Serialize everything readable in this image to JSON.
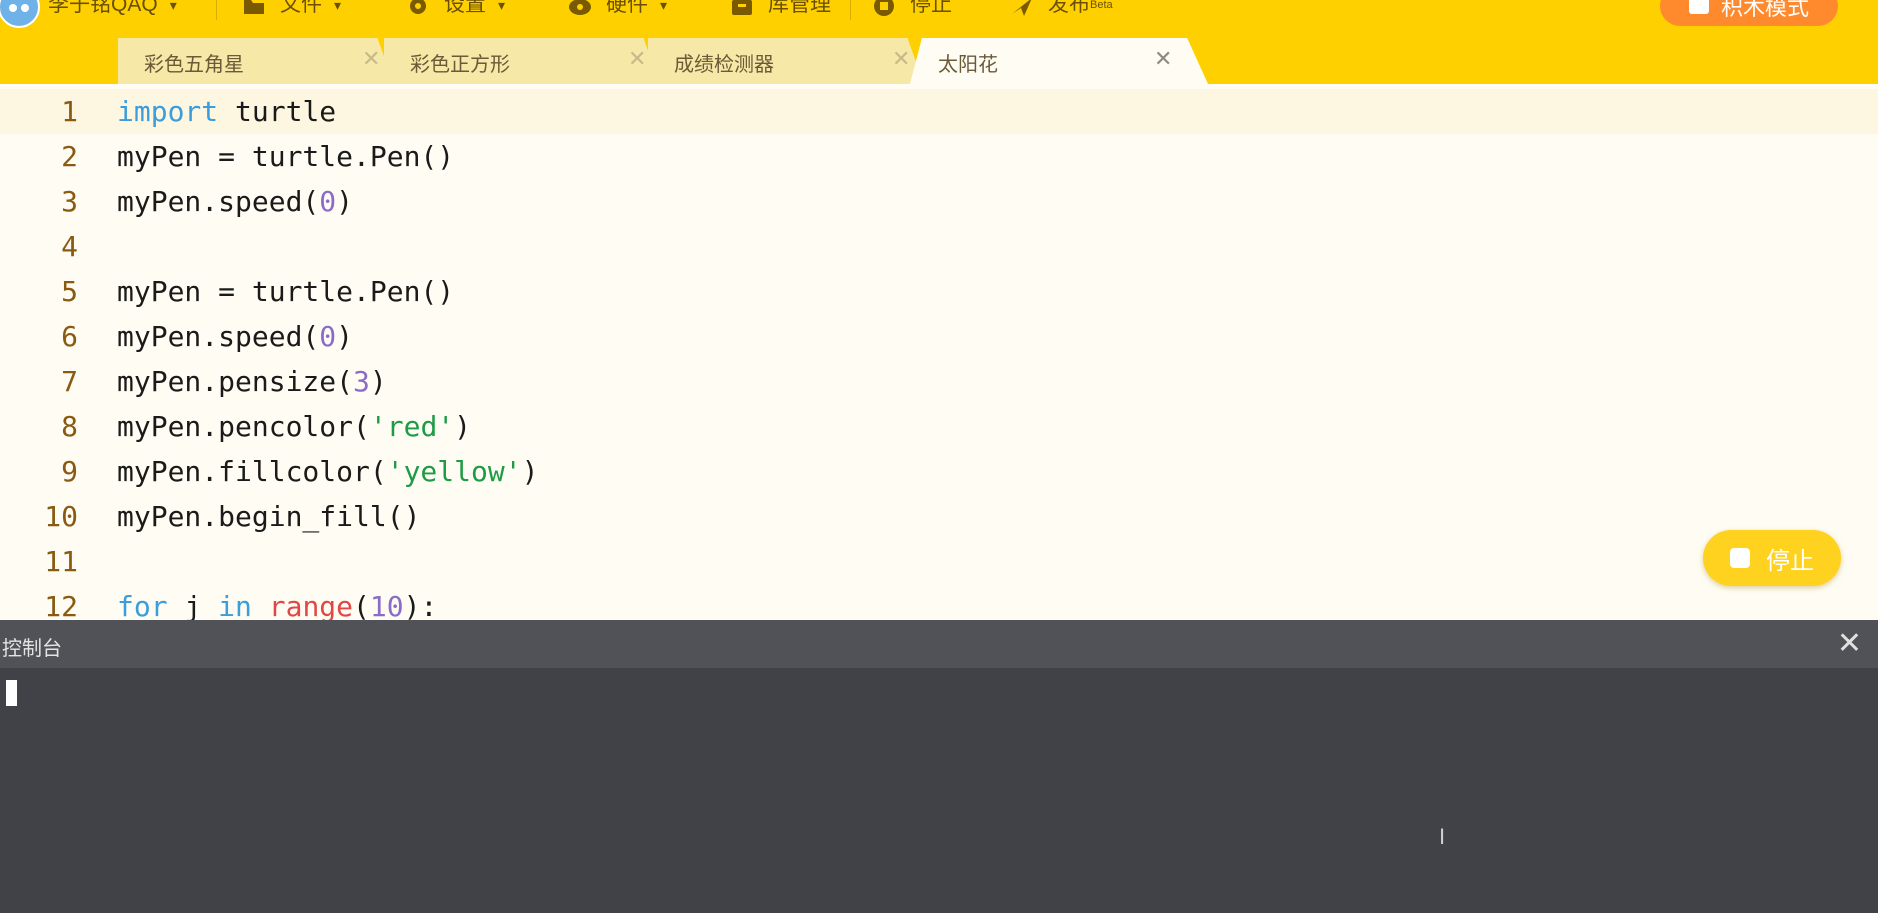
{
  "menubar": {
    "user": "李子铭QAQ",
    "file": "文件",
    "settings": "设置",
    "hardware": "硬件",
    "library": "库管理",
    "stop": "停止",
    "publish": "发布",
    "publish_badge": "Beta",
    "block_mode": "积木模式",
    "caret": "▾"
  },
  "tabs": [
    {
      "label": "彩色五角星",
      "close": "✕"
    },
    {
      "label": "彩色正方形",
      "close": "✕"
    },
    {
      "label": "成绩检测器",
      "close": "✕"
    },
    {
      "label": "太阳花",
      "close": "✕"
    }
  ],
  "editor": {
    "line_numbers": [
      "1",
      "2",
      "3",
      "4",
      "5",
      "6",
      "7",
      "8",
      "9",
      "10",
      "11",
      "12"
    ],
    "code": {
      "l1": {
        "kw": "import",
        "rest": " turtle"
      },
      "l2": {
        "text": "myPen = turtle.Pen()"
      },
      "l3": {
        "a": "myPen.speed(",
        "n": "0",
        "b": ")"
      },
      "l5": {
        "text": "myPen = turtle.Pen()"
      },
      "l6": {
        "a": "myPen.speed(",
        "n": "0",
        "b": ")"
      },
      "l7": {
        "a": "myPen.pensize(",
        "n": "3",
        "b": ")"
      },
      "l8": {
        "a": "myPen.pencolor(",
        "s": "'red'",
        "b": ")"
      },
      "l9": {
        "a": "myPen.fillcolor(",
        "s": "'yellow'",
        "b": ")"
      },
      "l10": {
        "text": "myPen.begin_fill()"
      },
      "l12": {
        "kw1": "for",
        "var": " j ",
        "kw2": "in",
        "sp": " ",
        "fn": "range",
        "p1": "(",
        "n": "10",
        "p2": "):"
      }
    }
  },
  "stop_button": {
    "label": "停止"
  },
  "console": {
    "title": "控制台",
    "close": "✕",
    "ibeam": "I"
  },
  "colors": {
    "accent": "#ffd000",
    "block_mode": "#ff8a2e",
    "console_bg": "#404247"
  }
}
